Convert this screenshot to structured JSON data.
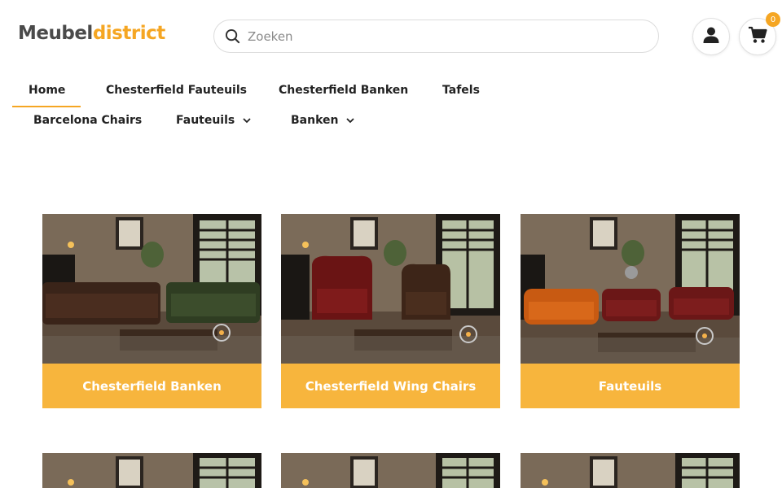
{
  "header": {
    "logo_part1": "Meubel",
    "logo_part2": "district",
    "search_placeholder": "Zoeken",
    "cart_count": "0",
    "account_icon": "user-icon",
    "cart_icon": "shopping-cart-icon",
    "search_icon": "search-icon"
  },
  "nav": {
    "items": [
      {
        "label": "Home",
        "active": true
      },
      {
        "label": "Chesterfield Fauteuils"
      },
      {
        "label": "Chesterfield Banken"
      },
      {
        "label": "Tafels"
      },
      {
        "label": "Barcelona Chairs"
      },
      {
        "label": "Fauteuils",
        "dropdown": true
      },
      {
        "label": "Banken",
        "dropdown": true
      }
    ]
  },
  "categories": [
    {
      "label": "Chesterfield Banken"
    },
    {
      "label": "Chesterfield Wing Chairs"
    },
    {
      "label": "Fauteuils"
    }
  ],
  "colors": {
    "accent": "#f5a623",
    "card_label_bg": "#f7b53d",
    "logo_dark": "#4a4a4a"
  }
}
